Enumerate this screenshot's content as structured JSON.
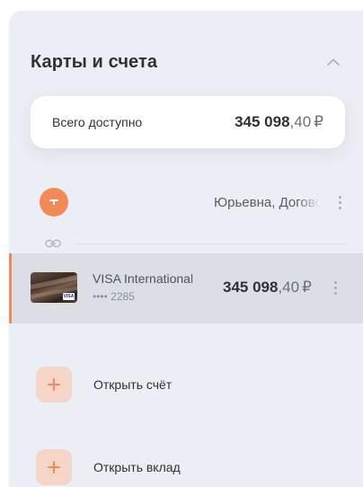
{
  "header": {
    "title": "Карты и счета"
  },
  "total": {
    "label": "Всего доступно",
    "amount_int": "345 098",
    "amount_frac": ",40",
    "currency": "₽"
  },
  "contract": {
    "name": "Юрьевна, Договор"
  },
  "card": {
    "name": "VISA International",
    "number": "•••• 2285",
    "amount_int": "345 098",
    "amount_frac": ",40",
    "currency": "₽",
    "brand": "VISA"
  },
  "actions": [
    {
      "label": "Открыть счёт"
    },
    {
      "label": "Открыть вклад"
    }
  ],
  "colors": {
    "accent": "#f28a57",
    "panel": "#eceef5",
    "selected_row": "#dcdee6"
  },
  "icons": [
    "chevron-up-icon",
    "kebab-icon",
    "link-icon",
    "plus-icon"
  ]
}
